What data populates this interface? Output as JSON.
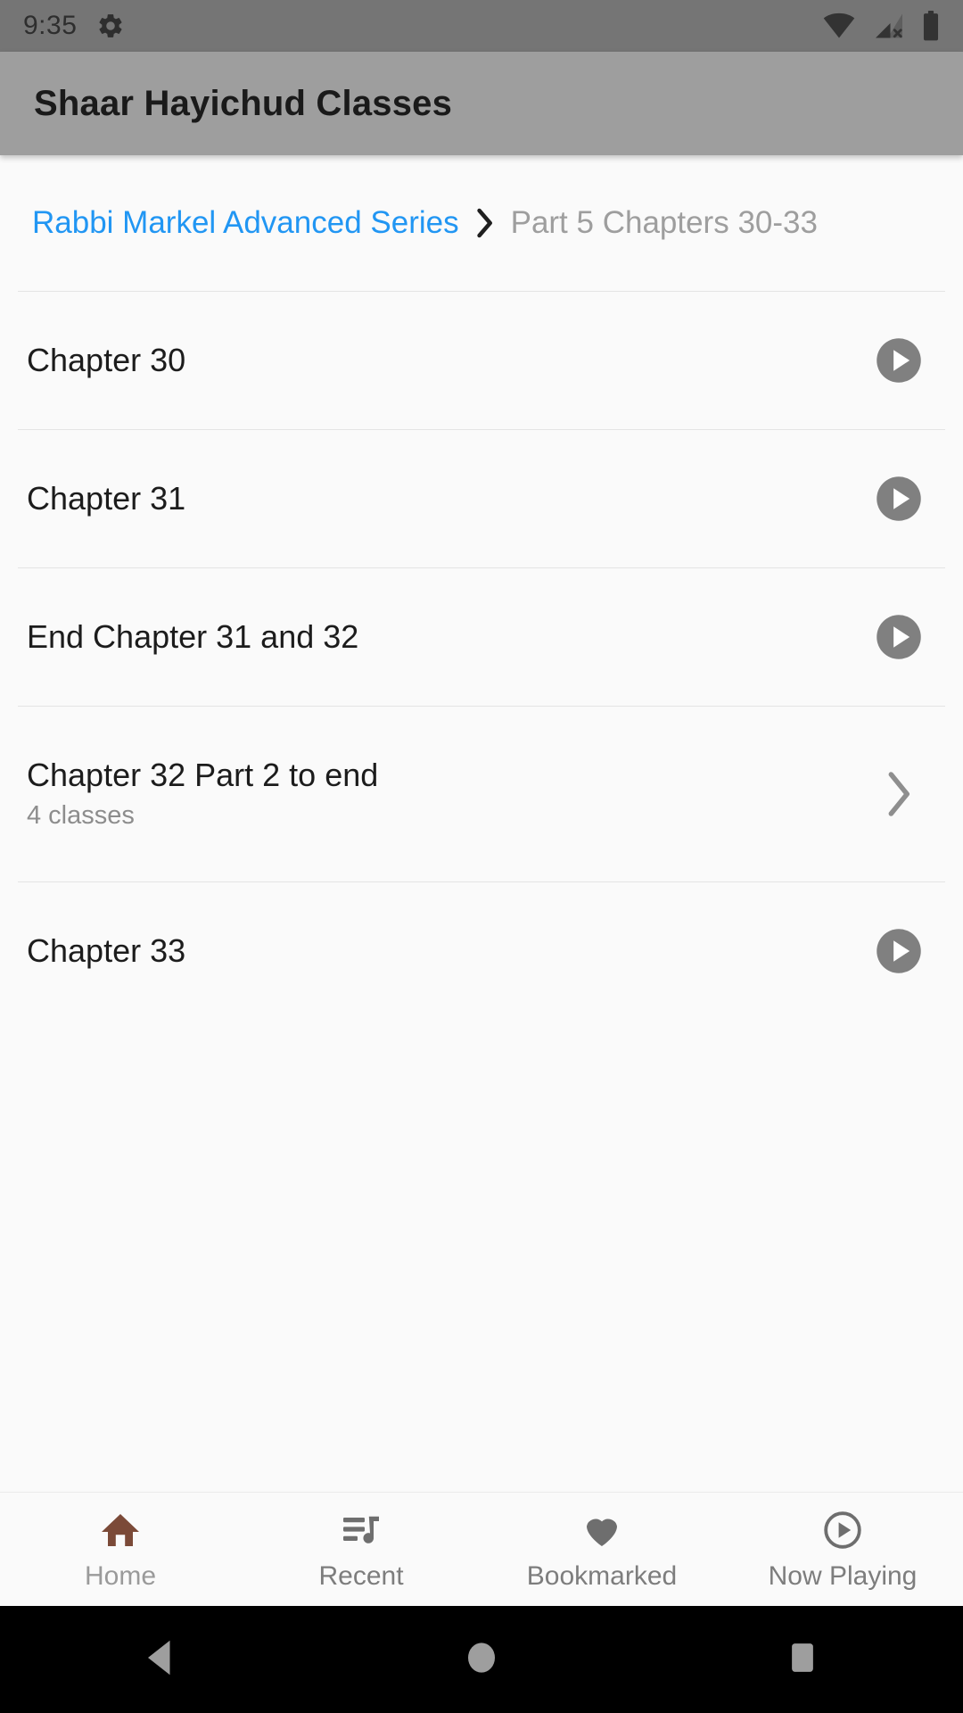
{
  "status_bar": {
    "time": "9:35",
    "icons": [
      "gear-icon",
      "wifi-icon",
      "cellular-no-sim-icon",
      "battery-icon"
    ],
    "background": "#757575"
  },
  "app_bar": {
    "title": "Shaar Hayichud Classes",
    "background": "#9e9e9e"
  },
  "breadcrumb": {
    "parent_label": "Rabbi Markel Advanced Series",
    "separator_icon": "chevron-right-icon",
    "current_label": "Part 5 Chapters 30-33",
    "link_color": "#2196f3",
    "current_color": "#9e9e9e"
  },
  "list": {
    "items": [
      {
        "title": "Chapter 30",
        "subtitle": "",
        "action": "play-icon"
      },
      {
        "title": "Chapter 31",
        "subtitle": "",
        "action": "play-icon"
      },
      {
        "title": "End Chapter 31 and 32",
        "subtitle": "",
        "action": "play-icon"
      },
      {
        "title": "Chapter 32 Part 2 to end",
        "subtitle": "4 classes",
        "action": "chevron-right-icon"
      },
      {
        "title": "Chapter 33",
        "subtitle": "",
        "action": "play-icon"
      }
    ]
  },
  "bottom_nav": {
    "active_color": "#7b4a38",
    "inactive_color": "#6e6e6e",
    "items": [
      {
        "label": "Home",
        "icon": "home-icon",
        "active": true
      },
      {
        "label": "Recent",
        "icon": "queue-music-icon",
        "active": false
      },
      {
        "label": "Bookmarked",
        "icon": "heart-icon",
        "active": false
      },
      {
        "label": "Now Playing",
        "icon": "play-circle-outline-icon",
        "active": false
      }
    ]
  },
  "android_nav": {
    "items": [
      {
        "icon": "back-triangle-icon"
      },
      {
        "icon": "home-circle-icon"
      },
      {
        "icon": "recents-square-icon"
      }
    ],
    "background": "#000000",
    "icon_color": "#9e9e9e"
  }
}
